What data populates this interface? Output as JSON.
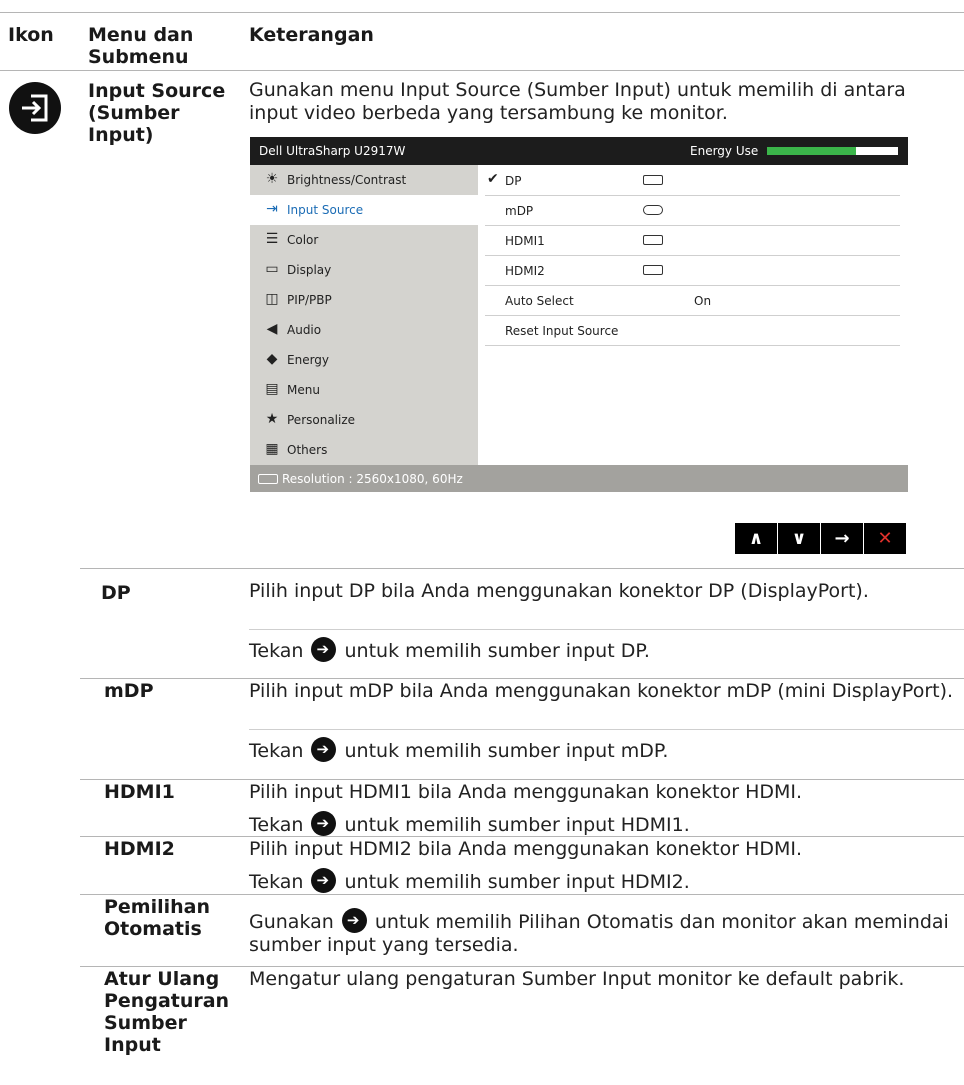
{
  "table_header": {
    "col_icon": "Ikon",
    "col_menu": "Menu dan\nSubmenu",
    "col_desc": "Keterangan"
  },
  "main_row": {
    "icon": "input-source-icon",
    "menu_label": "Input Source\n(Sumber\nInput)",
    "description": "Gunakan menu Input Source (Sumber Input) untuk memilih di antara input video berbeda yang tersambung ke monitor."
  },
  "osd": {
    "title": "Dell UltraSharp U2917W",
    "energy_label": "Energy Use",
    "energy_level_fraction": 0.68,
    "colors": {
      "energy_fill": "#3bb54a",
      "selected_text": "#1b6cb5"
    },
    "menu": [
      {
        "label": "Brightness/Contrast",
        "icon": "sun-icon",
        "selected": false
      },
      {
        "label": "Input Source",
        "icon": "input-source-icon",
        "selected": true
      },
      {
        "label": "Color",
        "icon": "color-icon",
        "selected": false
      },
      {
        "label": "Display",
        "icon": "display-icon",
        "selected": false
      },
      {
        "label": "PIP/PBP",
        "icon": "pip-icon",
        "selected": false
      },
      {
        "label": "Audio",
        "icon": "speaker-icon",
        "selected": false
      },
      {
        "label": "Energy",
        "icon": "leaf-icon",
        "selected": false
      },
      {
        "label": "Menu",
        "icon": "menu-icon",
        "selected": false
      },
      {
        "label": "Personalize",
        "icon": "star-icon",
        "selected": false
      },
      {
        "label": "Others",
        "icon": "grid-icon",
        "selected": false
      }
    ],
    "submenu": [
      {
        "label": "DP",
        "checked": true,
        "port": "dp-port-icon",
        "value": ""
      },
      {
        "label": "mDP",
        "checked": false,
        "port": "mdp-port-icon",
        "value": ""
      },
      {
        "label": "HDMI1",
        "checked": false,
        "port": "hdmi-port-icon",
        "value": ""
      },
      {
        "label": "HDMI2",
        "checked": false,
        "port": "hdmi-port-icon",
        "value": ""
      },
      {
        "label": "Auto Select",
        "checked": false,
        "port": "",
        "value": "On"
      },
      {
        "label": "Reset Input Source",
        "checked": false,
        "port": "",
        "value": ""
      }
    ],
    "status": "Resolution : 2560x1080, 60Hz"
  },
  "nav_buttons": [
    {
      "name": "up-button",
      "glyph": "⌃"
    },
    {
      "name": "down-button",
      "glyph": "⌄"
    },
    {
      "name": "right-button",
      "glyph": "→"
    },
    {
      "name": "exit-button",
      "glyph": "✕"
    }
  ],
  "rows": [
    {
      "name": "DP",
      "desc": "Pilih input DP bila Anda menggunakan konektor DP (DisplayPort).",
      "press_before": "Tekan",
      "press_after": "untuk memilih sumber input DP."
    },
    {
      "name": "mDP",
      "desc": "Pilih input mDP bila Anda menggunakan konektor mDP (mini DisplayPort).",
      "press_before": "Tekan",
      "press_after": "untuk memilih sumber input mDP."
    },
    {
      "name": "HDMI1",
      "desc": "Pilih input HDMI1 bila Anda menggunakan konektor HDMI.",
      "press_before": "Tekan",
      "press_after": "untuk memilih sumber input HDMI1."
    },
    {
      "name": "HDMI2",
      "desc": "Pilih input HDMI2 bila Anda menggunakan konektor HDMI.",
      "press_before": "Tekan",
      "press_after": "untuk memilih sumber input HDMI2."
    },
    {
      "name": "Pemilihan\nOtomatis",
      "desc_before": "Gunakan",
      "desc_after": "untuk memilih Pilihan Otomatis dan monitor akan memindai sumber input yang tersedia."
    },
    {
      "name": "Atur Ulang\nPengaturan\nSumber\nInput",
      "desc": "Mengatur ulang pengaturan Sumber Input monitor ke default pabrik."
    }
  ]
}
